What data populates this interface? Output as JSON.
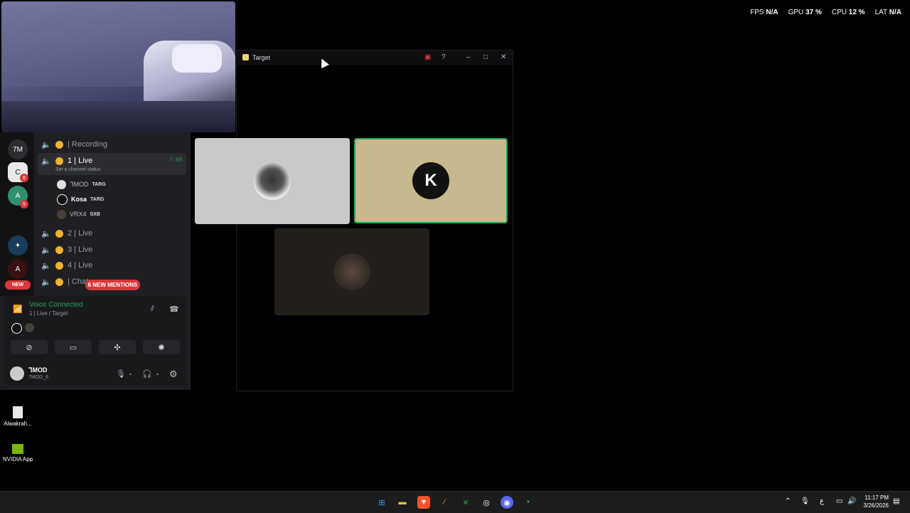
{
  "perf_overlay": {
    "fps_label": "FPS",
    "fps_value": "N/A",
    "gpu_label": "GPU",
    "gpu_value": "37 %",
    "cpu_label": "CPU",
    "cpu_value": "12 %",
    "lat_label": "LAT",
    "lat_value": "N/A"
  },
  "discord": {
    "server_badges": [
      "6",
      "5"
    ],
    "new_pill": "NEW",
    "channels": [
      {
        "label": "| Recording"
      },
      {
        "label": "1 | Live",
        "status": "Set a channel status",
        "timer": "7:05"
      },
      {
        "label": "2 | Live"
      },
      {
        "label": "3 | Live"
      },
      {
        "label": "4 | Live"
      },
      {
        "label": "| Chat"
      }
    ],
    "members": [
      {
        "name": "ᒣMOD",
        "tag": "TARG"
      },
      {
        "name": "Kosa",
        "tag": "TARG"
      },
      {
        "name": "VRX4",
        "tag": "SXB"
      }
    ],
    "mentions_pill": "6 NEW MENTIONS",
    "voice": {
      "title": "Voice Connected",
      "subtitle": "1 | Live / Target"
    },
    "user": {
      "name": "ᒣMOD",
      "subtext": "7MOD_6"
    }
  },
  "target_window": {
    "title": "Target"
  },
  "desktop_icons": [
    {
      "label": "Alwakrah..."
    },
    {
      "label": "NVIDIA App"
    }
  ],
  "taskbar": {
    "time": "11:17 PM",
    "date": "3/26/2026",
    "lang": "ع"
  },
  "colors": {
    "accent_green": "#23a55a",
    "alert_red": "#da373c",
    "coin": "#f0b232"
  }
}
